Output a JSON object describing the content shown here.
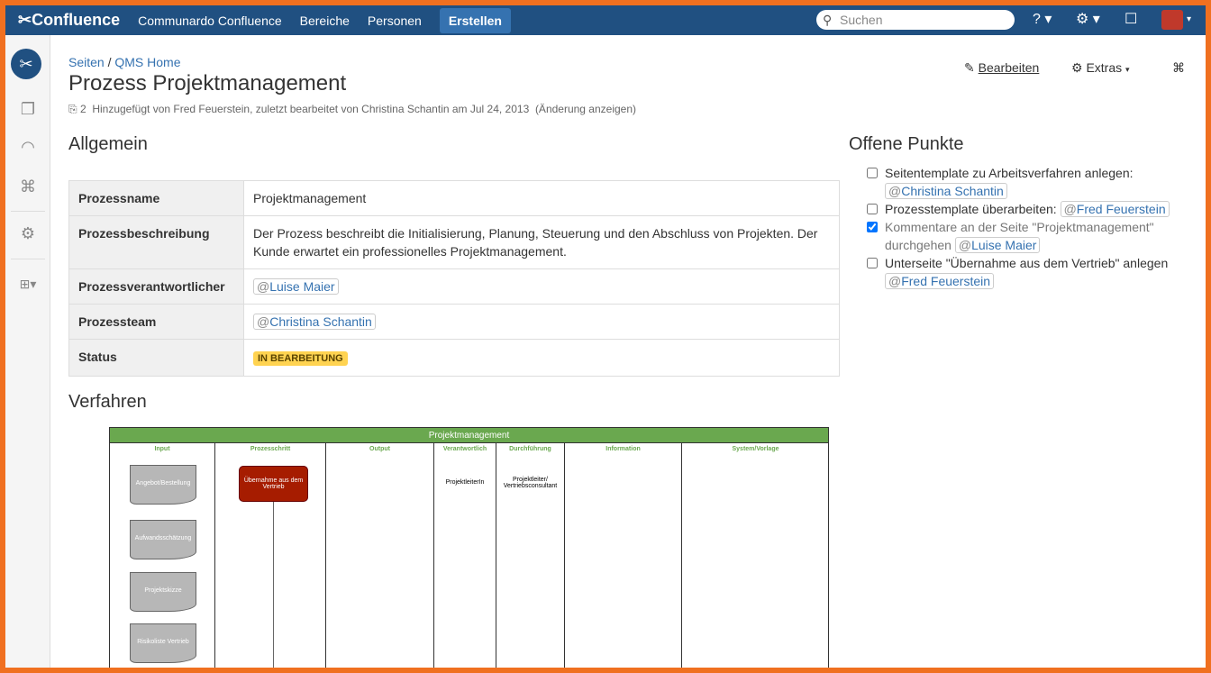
{
  "topbar": {
    "logo": "Confluence",
    "nav": [
      "Communardo Confluence",
      "Bereiche",
      "Personen"
    ],
    "create": "Erstellen",
    "search_placeholder": "Suchen"
  },
  "breadcrumb": {
    "items": [
      "Seiten",
      "QMS Home"
    ],
    "sep": "/"
  },
  "page": {
    "title": "Prozess Projektmanagement",
    "attachments": "2",
    "meta": "Hinzugefügt von Fred Feuerstein, zuletzt bearbeitet von Christina Schantin am Jul 24, 2013",
    "changes": "(Änderung anzeigen)"
  },
  "actions": {
    "edit": "Bearbeiten",
    "extras": "Extras"
  },
  "general": {
    "heading": "Allgemein",
    "rows": [
      {
        "k": "Prozessname",
        "v": "Projektmanagement"
      },
      {
        "k": "Prozessbeschreibung",
        "v": "Der Prozess beschreibt die Initialisierung, Planung, Steuerung und den Abschluss von Projekten. Der Kunde erwartet ein professionelles Projektmanagement."
      },
      {
        "k": "Prozessverantwortlicher",
        "v": "Luise Maier"
      },
      {
        "k": "Prozessteam",
        "v": "Christina Schantin"
      },
      {
        "k": "Status",
        "v": "IN BEARBEITUNG"
      }
    ]
  },
  "tasks": {
    "heading": "Offene Punkte",
    "items": [
      {
        "text": "Seitentemplate zu Arbeitsverfahren anlegen:",
        "mention": "Christina Schantin",
        "done": false
      },
      {
        "text": "Prozesstemplate überarbeiten:",
        "mention": "Fred Feuerstein",
        "done": false
      },
      {
        "text": "Kommentare an der Seite \"Projektmanagement\" durchgehen",
        "mention": "Luise Maier",
        "done": true
      },
      {
        "text": "Unterseite \"Übernahme aus dem Vertrieb\" anlegen",
        "mention": "Fred Feuerstein",
        "done": false
      }
    ]
  },
  "procedure": {
    "heading": "Verfahren",
    "diagram": {
      "title": "Projektmanagement",
      "columns": [
        "Input",
        "Prozesschritt",
        "Output",
        "Verantwortlich",
        "Durchführung",
        "Information",
        "System/Vorlage"
      ],
      "inputs": [
        "Angebot/Bestellung",
        "Aufwandsschätzung",
        "Projektskizze",
        "Risikoliste Vertrieb"
      ],
      "step": "Übernahme aus dem Vertrieb",
      "responsible": "ProjektleiterIn",
      "execution": "Projektleiter/ Vertriebsconsultant"
    }
  }
}
